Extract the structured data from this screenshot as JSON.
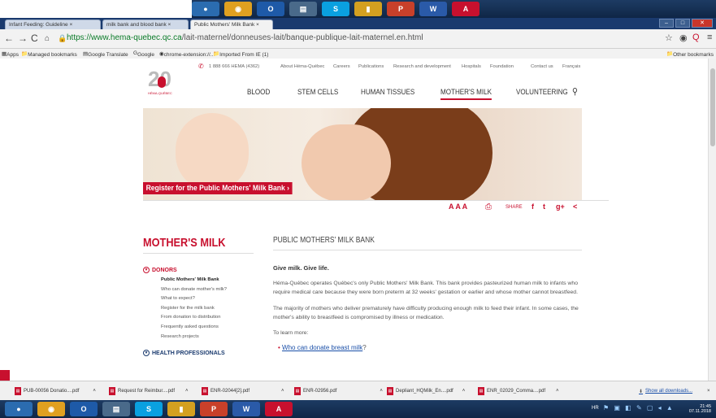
{
  "browser": {
    "tabs": [
      {
        "label": "Infant Feeding: Guideline"
      },
      {
        "label": "milk bank and blood bank"
      },
      {
        "label": "Public Mothers' Milk Bank"
      }
    ],
    "url_scheme": "https://",
    "url_host": "www.hema-quebec.qc.ca",
    "url_path": "/lait-maternel/donneuses-lait/banque-publique-lait-maternel.en.html",
    "bookmarks": [
      "Apps",
      "Managed bookmarks",
      "Google Translate",
      "Google",
      "chrome-extension://...",
      "Imported From IE (1)"
    ],
    "other_bookmarks": "Other bookmarks"
  },
  "site": {
    "phone": "1 888 666 HEMA (4362)",
    "utility_links": [
      "About Héma-Québec",
      "Careers",
      "Publications",
      "Research and development",
      "Hospitals",
      "Foundation",
      "Contact us",
      "Français"
    ],
    "logo_number": "20",
    "logo_name": "HÉMA-QUÉBEC",
    "nav": [
      "BLOOD",
      "STEM CELLS",
      "HUMAN TISSUES",
      "MOTHER'S MILK",
      "VOLUNTEERING"
    ],
    "hero_cta": "Register for the Public Mothers' Milk Bank ›",
    "font_sizes": "A A A",
    "share_label": "SHARE",
    "social": [
      "f",
      "t",
      "g+",
      "<"
    ]
  },
  "sidebar": {
    "title": "MOTHER'S MILK",
    "donors_label": "DONORS",
    "items": [
      "Public Mothers' Milk Bank",
      "Who can donate mother's milk?",
      "What to expect?",
      "Register for the milk bank",
      "From donation to distribution",
      "Frequently asked questions",
      "Research projects"
    ],
    "health_label": "HEALTH PROFESSIONALS"
  },
  "content": {
    "title": "PUBLIC MOTHERS' MILK BANK",
    "subtitle": "Give milk. Give life.",
    "paragraphs": [
      "Héma-Québec operates Québec's only Public Mothers' Milk Bank. This bank provides pasteurized human milk to infants who require medical care because they were born preterm at 32 weeks' gestation or earlier and whose mother cannot breastfeed.",
      "The majority of mothers who deliver prematurely have difficulty producing enough milk to feed their infant. In some cases, the mother's ability to breastfeed is compromised by illness or medication.",
      "To learn more:"
    ],
    "link": "Who can donate breast milk",
    "link_suffix": "?"
  },
  "downloads": {
    "files": [
      "PUB-00056 Donatio....pdf",
      "Request for Reimbur....pdf",
      "ENR-02044[2].pdf",
      "ENR-02956.pdf",
      "Depliant_HQMilk_En....pdf",
      "ENR_02029_Comma....pdf"
    ],
    "show_all": "Show all downloads..."
  },
  "taskbar": {
    "lang": "HR",
    "time": "21:45",
    "date": "07.11.2018"
  }
}
